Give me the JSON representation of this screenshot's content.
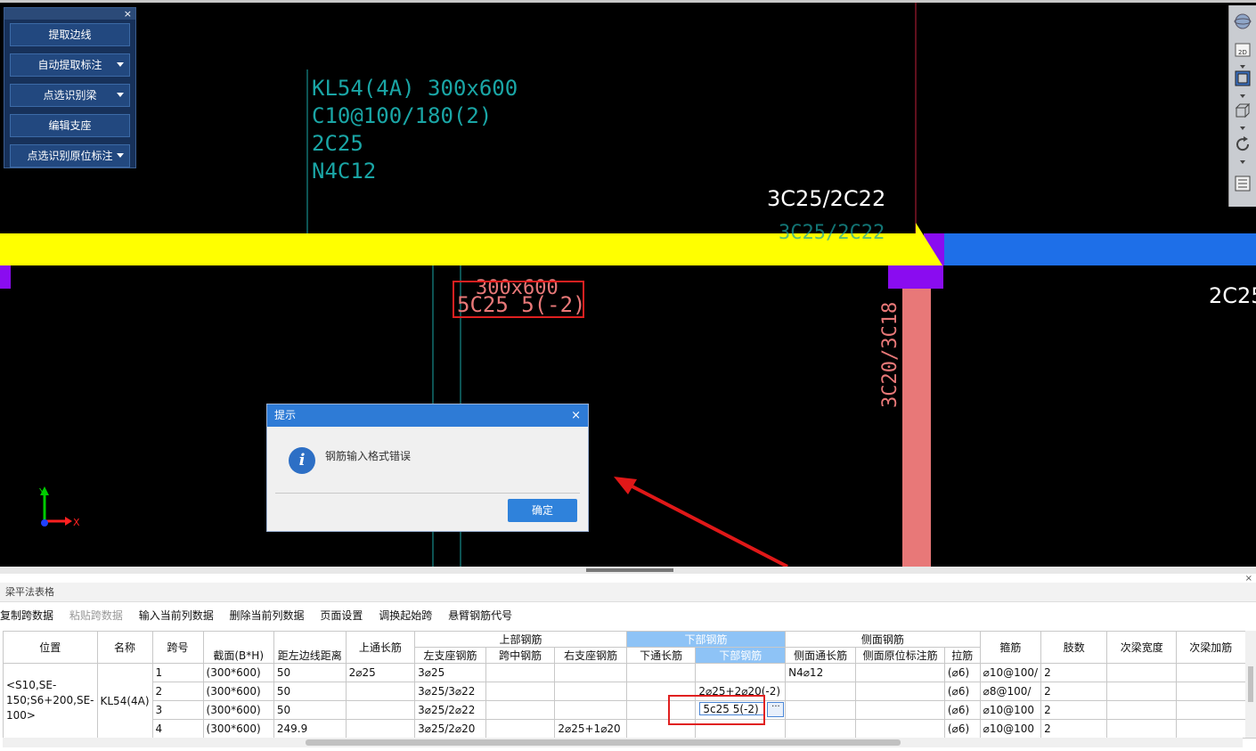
{
  "panel": {
    "buttons": [
      {
        "label": "提取边线",
        "dropdown": false
      },
      {
        "label": "自动提取标注",
        "dropdown": true
      },
      {
        "label": "点选识别梁",
        "dropdown": true
      },
      {
        "label": "编辑支座",
        "dropdown": false
      },
      {
        "label": "点选识别原位标注",
        "dropdown": true
      }
    ],
    "close_glyph": "×"
  },
  "cad": {
    "beam_annotation": [
      "KL54(4A) 300x600",
      "C10@100/180(2)",
      "2C25",
      "N4C12"
    ],
    "top_rebar_label": "3C25/2C22",
    "top_rebar_label_ghost": "3C25/2C22",
    "section_label": "300x600",
    "bottom_rebar_text": "5C25 5(-2)",
    "right_label": "2C25",
    "column_label": "3C20/3C18",
    "axis_x": "X",
    "axis_y": "Y",
    "colors": {
      "beam": "#ffff00",
      "beam_right": "#1e6fe8",
      "support": "#8a0cf0",
      "column": "#e87878",
      "annotation": "#1aa6a6"
    }
  },
  "toolbar_icons": [
    "globe-icon",
    "2d-view-icon",
    "3d-box-icon",
    "cube-icon",
    "rotate-icon",
    "layers-icon"
  ],
  "toolbar_2d_label": "2D",
  "dialog": {
    "title": "提示",
    "close_glyph": "×",
    "message": "钢筋输入格式错误",
    "ok_label": "确定"
  },
  "table_section": {
    "title": "梁平法表格",
    "close_glyph": "×",
    "toolbar": [
      "复制跨数据",
      "粘贴跨数据",
      "输入当前列数据",
      "删除当前列数据",
      "页面设置",
      "调换起始跨",
      "悬臂钢筋代号"
    ],
    "toolbar_disabled": [
      "粘贴跨数据"
    ],
    "headers": {
      "pos": "位置",
      "name": "名称",
      "span": "跨号",
      "section": "截面(B*H)",
      "dist": "距左边线距离",
      "top_through": "上通长筋",
      "top_group": "上部钢筋",
      "left_support": "左支座钢筋",
      "mid_span": "跨中钢筋",
      "right_support": "右支座钢筋",
      "bottom_group": "下部钢筋",
      "bottom_through": "下通长筋",
      "bottom_rebar": "下部钢筋",
      "side_group": "侧面钢筋",
      "side_through": "侧面通长筋",
      "side_orig": "侧面原位标注筋",
      "tie": "拉筋",
      "stirrup": "箍筋",
      "legs": "肢数",
      "sec_width": "次梁宽度",
      "sec_add": "次梁加筋"
    },
    "position": "<S10,SE-150;S6+200,SE-100>",
    "name": "KL54(4A)",
    "rows": [
      {
        "span": "1",
        "section": "(300*600)",
        "dist": "50",
        "top_through": "2⌀25",
        "left_support": "3⌀25",
        "mid": "",
        "right_support": "",
        "bottom_through": "",
        "bottom": "",
        "side_through": "N4⌀12",
        "side_orig": "",
        "tie": "(⌀6)",
        "stirrup": "⌀10@100/",
        "legs": "2"
      },
      {
        "span": "2",
        "section": "(300*600)",
        "dist": "50",
        "top_through": "",
        "left_support": "3⌀25/3⌀22",
        "mid": "",
        "right_support": "",
        "bottom_through": "",
        "bottom": "2⌀25+2⌀20(-2)",
        "side_through": "",
        "side_orig": "",
        "tie": "(⌀6)",
        "stirrup": "⌀8@100/",
        "legs": "2"
      },
      {
        "span": "3",
        "section": "(300*600)",
        "dist": "50",
        "top_through": "",
        "left_support": "3⌀25/2⌀22",
        "mid": "",
        "right_support": "",
        "bottom_through": "",
        "bottom": "5c25 5(-2)",
        "side_through": "",
        "side_orig": "",
        "tie": "(⌀6)",
        "stirrup": "⌀10@100",
        "legs": "2"
      },
      {
        "span": "4",
        "section": "(300*600)",
        "dist": "249.9",
        "top_through": "",
        "left_support": "3⌀25/2⌀20",
        "mid": "",
        "right_support": "2⌀25+1⌀20",
        "bottom_through": "",
        "bottom": "",
        "side_through": "",
        "side_orig": "",
        "tie": "(⌀6)",
        "stirrup": "⌀10@100",
        "legs": "2"
      }
    ],
    "edit_button_glyph": "···",
    "left_row_markers": [
      "1",
      "2",
      "3",
      "4"
    ]
  }
}
